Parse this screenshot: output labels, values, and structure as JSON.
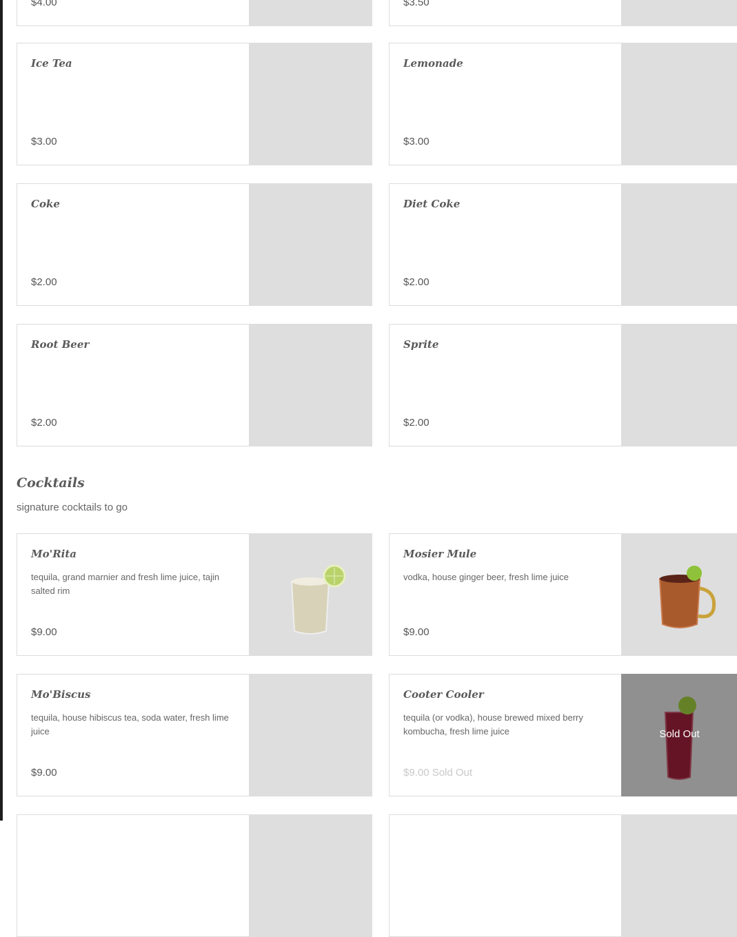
{
  "top_partial": {
    "left_price": "$4.00",
    "right_price": "$3.50"
  },
  "drinks": [
    {
      "name": "Ice Tea",
      "price": "$3.00"
    },
    {
      "name": "Lemonade",
      "price": "$3.00"
    },
    {
      "name": "Coke",
      "price": "$2.00"
    },
    {
      "name": "Diet Coke",
      "price": "$2.00"
    },
    {
      "name": "Root Beer",
      "price": "$2.00"
    },
    {
      "name": "Sprite",
      "price": "$2.00"
    }
  ],
  "cocktails_section": {
    "title": "Cocktails",
    "subtitle": "signature cocktails to go"
  },
  "cocktails": [
    {
      "name": "Mo'Rita",
      "description": "tequila, grand marnier and fresh lime juice, tajin salted rim",
      "price": "$9.00"
    },
    {
      "name": "Mosier Mule",
      "description": "vodka, house ginger beer, fresh lime juice",
      "price": "$9.00"
    },
    {
      "name": "Mo'Biscus",
      "description": "tequila, house hibiscus tea, soda water, fresh lime juice",
      "price": "$9.00"
    },
    {
      "name": "Cooter Cooler",
      "description": "tequila (or vodka), house brewed mixed berry kombucha, fresh lime juice",
      "price": "$9.00 Sold Out",
      "overlay": "Sold Out"
    }
  ],
  "colors": {
    "placeholder": "#dedede",
    "card_border": "#dcdcdc",
    "sold_out_text": "#c8c8c8"
  }
}
